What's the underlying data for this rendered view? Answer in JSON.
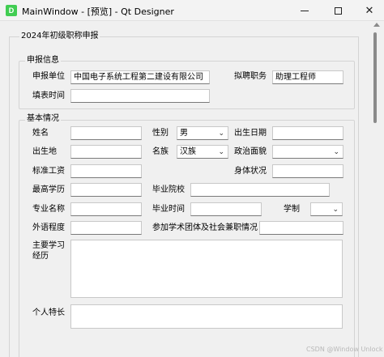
{
  "window": {
    "app_icon_letter": "D",
    "title": "MainWindow - [预览] - Qt Designer",
    "min_icon": "minimize-icon",
    "max_icon": "maximize-icon",
    "close_icon": "close-icon",
    "close_glyph": "✕"
  },
  "form": {
    "outer_title": "2024年初级职称申报",
    "apply_group": {
      "title": "申报信息",
      "unit_label": "申报单位",
      "unit_value": "中国电子系统工程第二建设有限公司",
      "position_label": "拟聘职务",
      "position_value": "助理工程师",
      "date_label": "填表时间",
      "date_value": ""
    },
    "basic_group": {
      "title": "基本情况",
      "name_label": "姓名",
      "gender_label": "性别",
      "gender_value": "男",
      "birthdate_label": "出生日期",
      "birthplace_label": "出生地",
      "ethnicity_label": "名族",
      "ethnicity_value": "汉族",
      "political_label": "政治面貌",
      "political_value": "",
      "salary_label": "标准工资",
      "health_label": "身体状况",
      "education_label": "最高学历",
      "school_label": "毕业院校",
      "major_label": "专业名称",
      "grad_time_label": "毕业时间",
      "degree_label": "学制",
      "degree_value": "",
      "foreign_label": "外语程度",
      "society_label": "参加学术团体及社会兼职情况",
      "resume_label": "主要学习\n经历",
      "specialty_label": "个人特长"
    }
  },
  "watermark": "CSDN @Window Unlock"
}
